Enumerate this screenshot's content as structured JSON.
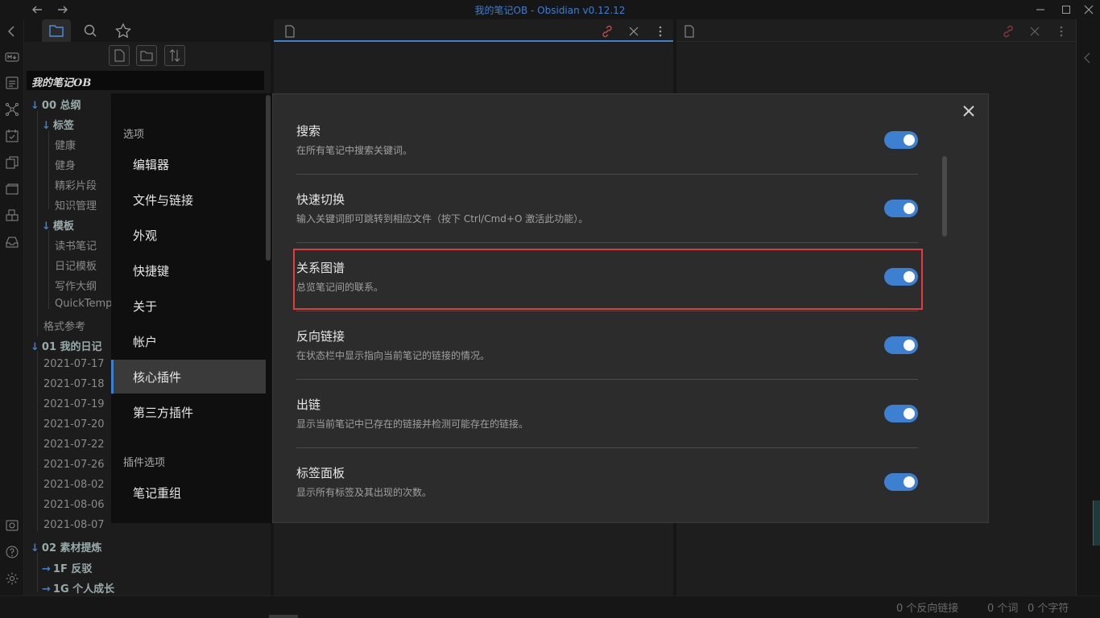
{
  "window": {
    "title": "我的笔记OB - Obsidian v0.12.12"
  },
  "sidebar": {
    "vault_name": "我的笔记OB",
    "tree": [
      {
        "label": "00 总纲",
        "type": "folder",
        "expanded": true
      },
      {
        "label": "标签",
        "type": "folder",
        "expanded": true
      },
      {
        "label": "健康",
        "type": "file"
      },
      {
        "label": "健身",
        "type": "file"
      },
      {
        "label": "精彩片段",
        "type": "file"
      },
      {
        "label": "知识管理",
        "type": "file"
      },
      {
        "label": "模板",
        "type": "folder",
        "expanded": true
      },
      {
        "label": "读书笔记",
        "type": "file"
      },
      {
        "label": "日记模板",
        "type": "file"
      },
      {
        "label": "写作大纲",
        "type": "file"
      },
      {
        "label": "QuickTemp",
        "type": "file"
      },
      {
        "label": "格式参考",
        "type": "file"
      },
      {
        "label": "01 我的日记",
        "type": "folder",
        "expanded": true
      },
      {
        "label": "2021-07-17",
        "type": "file"
      },
      {
        "label": "2021-07-18",
        "type": "file"
      },
      {
        "label": "2021-07-19",
        "type": "file"
      },
      {
        "label": "2021-07-20",
        "type": "file"
      },
      {
        "label": "2021-07-22",
        "type": "file"
      },
      {
        "label": "2021-07-26",
        "type": "file"
      },
      {
        "label": "2021-08-02",
        "type": "file"
      },
      {
        "label": "2021-08-06",
        "type": "file"
      },
      {
        "label": "2021-08-07",
        "type": "file"
      },
      {
        "label": "02 素材提炼",
        "type": "folder",
        "expanded": true
      },
      {
        "label": "1F 反驳",
        "type": "folder",
        "expanded": false
      },
      {
        "label": "1G 个人成长",
        "type": "folder",
        "expanded": false
      }
    ]
  },
  "settings": {
    "nav_heading_options": "选项",
    "nav_items": [
      "编辑器",
      "文件与链接",
      "外观",
      "快捷键",
      "关于",
      "帐户",
      "核心插件",
      "第三方插件"
    ],
    "active_nav": "核心插件",
    "nav_heading_plugin_options": "插件选项",
    "plugin_option_items": [
      "笔记重组"
    ],
    "core_plugins": [
      {
        "name": "搜索",
        "desc": "在所有笔记中搜索关键词。",
        "enabled": true
      },
      {
        "name": "快速切换",
        "desc": "输入关键词即可跳转到相应文件（按下 Ctrl/Cmd+O 激活此功能）。",
        "enabled": true
      },
      {
        "name": "关系图谱",
        "desc": "总览笔记间的联系。",
        "enabled": true,
        "highlighted": true
      },
      {
        "name": "反向链接",
        "desc": "在状态栏中显示指向当前笔记的链接的情况。",
        "enabled": true
      },
      {
        "name": "出链",
        "desc": "显示当前笔记中已存在的链接并检测可能存在的链接。",
        "enabled": true
      },
      {
        "name": "标签面板",
        "desc": "显示所有标签及其出现的次数。",
        "enabled": true
      }
    ]
  },
  "statusbar": {
    "backlinks": "0 个反向链接",
    "words": "0 个词",
    "chars": "0 个字符"
  },
  "colors": {
    "accent": "#3d7fd1",
    "highlight": "#e23c3c"
  }
}
